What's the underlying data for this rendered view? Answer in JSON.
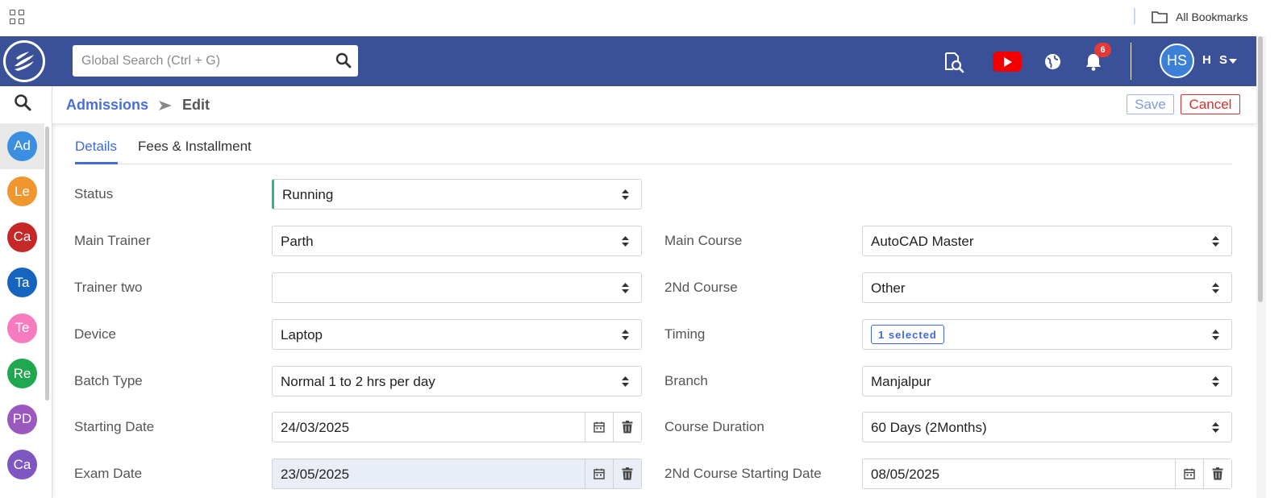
{
  "browser": {
    "all_bookmarks": "All Bookmarks"
  },
  "header": {
    "search_placeholder": "Global Search (Ctrl + G)",
    "notification_count": "6",
    "user_initials": "HS",
    "user_name": "H S",
    "colors": {
      "primary": "#3a5199",
      "youtube": "#f20000",
      "badge": "#e53935"
    }
  },
  "sidebar": {
    "items": [
      {
        "label": "Ad",
        "color": "#3b8fe0"
      },
      {
        "label": "Le",
        "color": "#f0962f"
      },
      {
        "label": "Ca",
        "color": "#c62828"
      },
      {
        "label": "Ta",
        "color": "#1565c0"
      },
      {
        "label": "Te",
        "color": "#f77bbf"
      },
      {
        "label": "Re",
        "color": "#1fa84f"
      },
      {
        "label": "PD",
        "color": "#9b59c0"
      },
      {
        "label": "Ca",
        "color": "#7e57c2"
      }
    ]
  },
  "breadcrumb": {
    "parent": "Admissions",
    "current": "Edit"
  },
  "toolbar": {
    "save_label": "Save",
    "cancel_label": "Cancel"
  },
  "tabs": [
    {
      "label": "Details",
      "active": true
    },
    {
      "label": "Fees & Installment",
      "active": false
    }
  ],
  "form": {
    "status": {
      "label": "Status",
      "value": "Running"
    },
    "main_trainer": {
      "label": "Main Trainer",
      "value": "Parth"
    },
    "trainer_two": {
      "label": "Trainer two",
      "value": ""
    },
    "device": {
      "label": "Device",
      "value": "Laptop"
    },
    "batch_type": {
      "label": "Batch Type",
      "value": "Normal 1 to 2 hrs per day"
    },
    "starting_date": {
      "label": "Starting Date",
      "value": "24/03/2025"
    },
    "exam_date": {
      "label": "Exam Date",
      "value": "23/05/2025"
    },
    "main_course": {
      "label": "Main Course",
      "value": "AutoCAD Master"
    },
    "second_course": {
      "label": "2Nd Course",
      "value": "Other"
    },
    "timing": {
      "label": "Timing",
      "value": "1 selected"
    },
    "branch": {
      "label": "Branch",
      "value": "Manjalpur"
    },
    "course_duration": {
      "label": "Course Duration",
      "value": "60 Days (2Months)"
    },
    "second_course_starting_date": {
      "label": "2Nd Course Starting Date",
      "value": "08/05/2025"
    }
  }
}
